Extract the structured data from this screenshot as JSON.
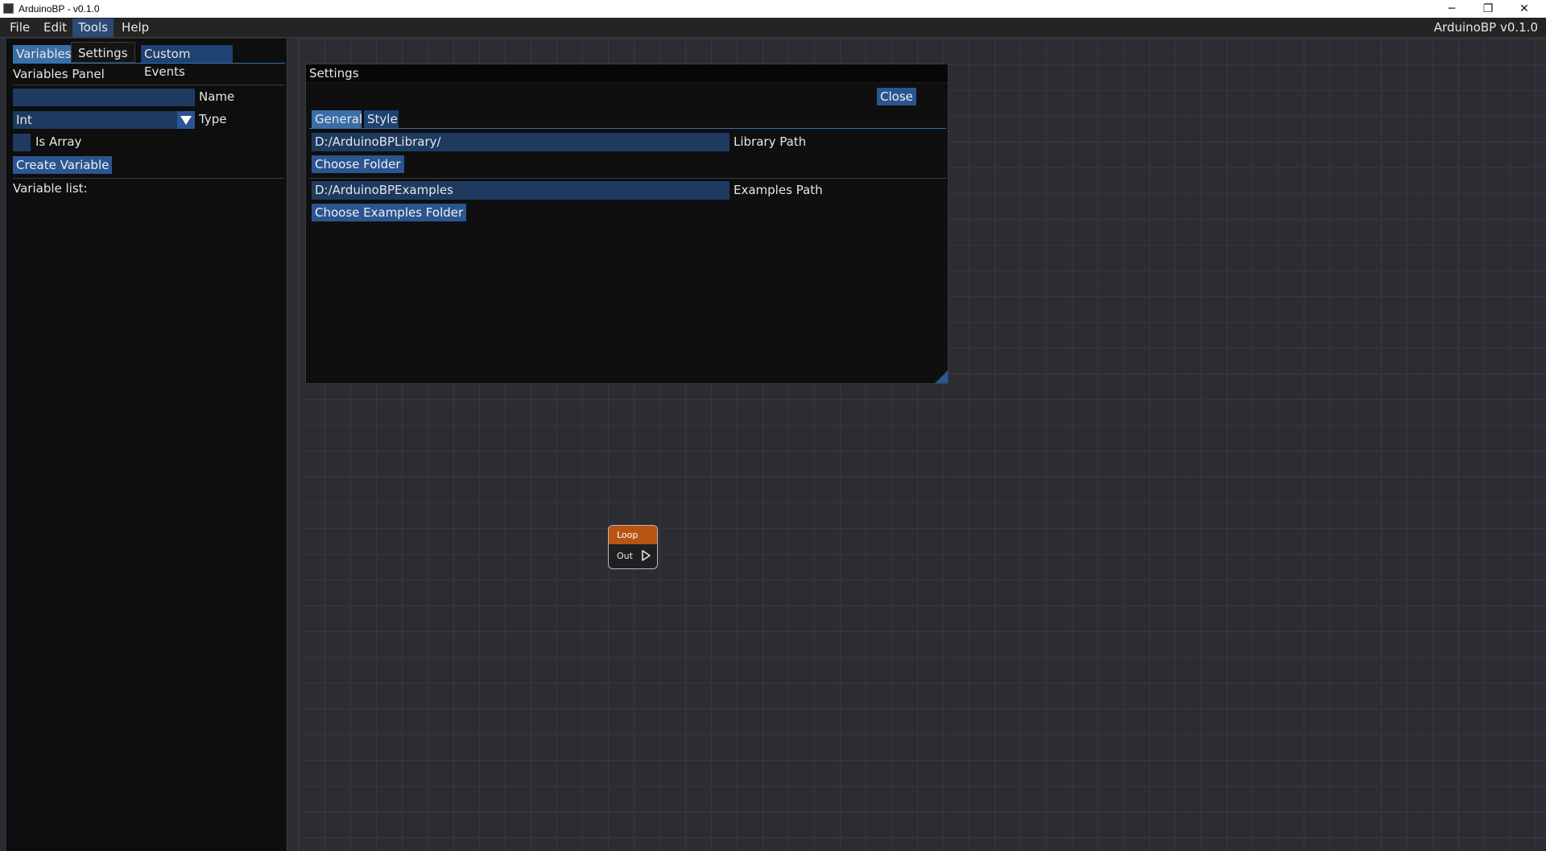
{
  "window": {
    "title": "ArduinoBP - v0.1.0",
    "minimize": "─",
    "maximize": "❐",
    "close": "✕"
  },
  "menubar": {
    "items": [
      "File",
      "Edit",
      "Tools",
      "Help"
    ],
    "version": "ArduinoBP v0.1.0"
  },
  "left_panel": {
    "tabs": [
      "Variables",
      "Custom Events"
    ],
    "tooltip": "Settings",
    "heading": "Variables Panel",
    "name_value": "",
    "name_label": "Name",
    "type_value": "Int",
    "type_label": "Type",
    "is_array_label": "Is Array",
    "is_array_checked": false,
    "create_button": "Create Variable",
    "variable_list_label": "Variable list:"
  },
  "settings": {
    "title": "Settings",
    "close_button": "Close",
    "tabs": [
      "General",
      "Style"
    ],
    "library_path_value": "D:/ArduinoBPLibrary/",
    "library_path_label": "Library Path",
    "choose_folder_button": "Choose Folder",
    "examples_path_value": "D:/ArduinoBPExamples",
    "examples_path_label": "Examples Path",
    "choose_examples_button": "Choose Examples Folder"
  },
  "canvas": {
    "nodes": [
      {
        "title": "Loop",
        "pin_label": "Out",
        "header_color": "#b85414"
      }
    ]
  },
  "colors": {
    "accent": "#3a6ea8",
    "button": "#2a5590",
    "frame": "#1e3a60",
    "panel_bg": "#0e0e0e"
  }
}
